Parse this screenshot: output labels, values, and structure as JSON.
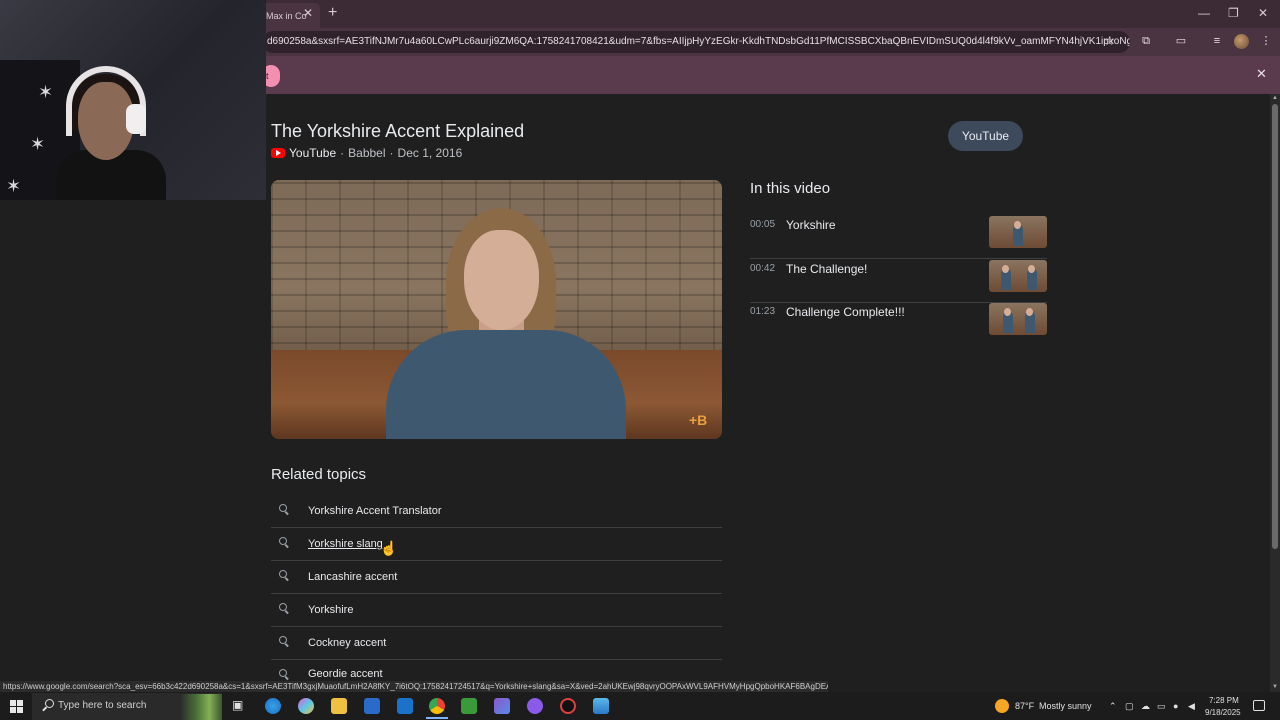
{
  "browser": {
    "tab_title": "Max in Co",
    "url": "d690258a&sxsrf=AE3TifNJMr7u4a60LCwPLc6aurji9ZM6QA:1758241708421&udm=7&fbs=AIIjpHyYzEGkr-KkdhTNDsbGd11PfMCISSBCXbaQBnEVIDmSUQ0d4l4f9kVv_oamMFYN4hjVK1ipkoNgoK7QRX...",
    "infobar_pill": "t"
  },
  "video": {
    "title": "The Yorkshire Accent Explained",
    "source": "YouTube",
    "channel": "Babbel",
    "date": "Dec 1, 2016",
    "separator": "·",
    "open_button": "YouTube",
    "watermark": "+B"
  },
  "chapters": {
    "heading": "In this video",
    "items": [
      {
        "time": "00:05",
        "label": "Yorkshire"
      },
      {
        "time": "00:42",
        "label": "The Challenge!"
      },
      {
        "time": "01:23",
        "label": "Challenge Complete!!!"
      }
    ]
  },
  "related": {
    "heading": "Related topics",
    "items": [
      {
        "label": "Yorkshire Accent Translator"
      },
      {
        "label": "Yorkshire slang"
      },
      {
        "label": "Lancashire accent"
      },
      {
        "label": "Yorkshire"
      },
      {
        "label": "Cockney accent"
      },
      {
        "label": "Geordie accent"
      }
    ]
  },
  "status_url": "https://www.google.com/search?sca_esv=66b3c422d690258a&cs=1&sxsrf=AE3TifM3gxjMuaofufLmH2A8fKY_7i6tOQ:1758241724517&q=Yorkshire+slang&sa=X&ved=2ahUKEwj98qvryOOPAxWVL9AFHVMyHpgQpboHKAF6BAgDEAM",
  "taskbar": {
    "search_placeholder": "Type here to search",
    "temperature": "87°F",
    "weather": "Mostly sunny",
    "time": "7:28 PM",
    "date": "9/18/2025"
  },
  "colors": {
    "page_bg": "#1f1f1f",
    "chrome_frame": "#3c2a35",
    "infobar": "#5a3b4d",
    "youtube_red": "#ff0000",
    "button_bg": "#3c4a5c"
  }
}
